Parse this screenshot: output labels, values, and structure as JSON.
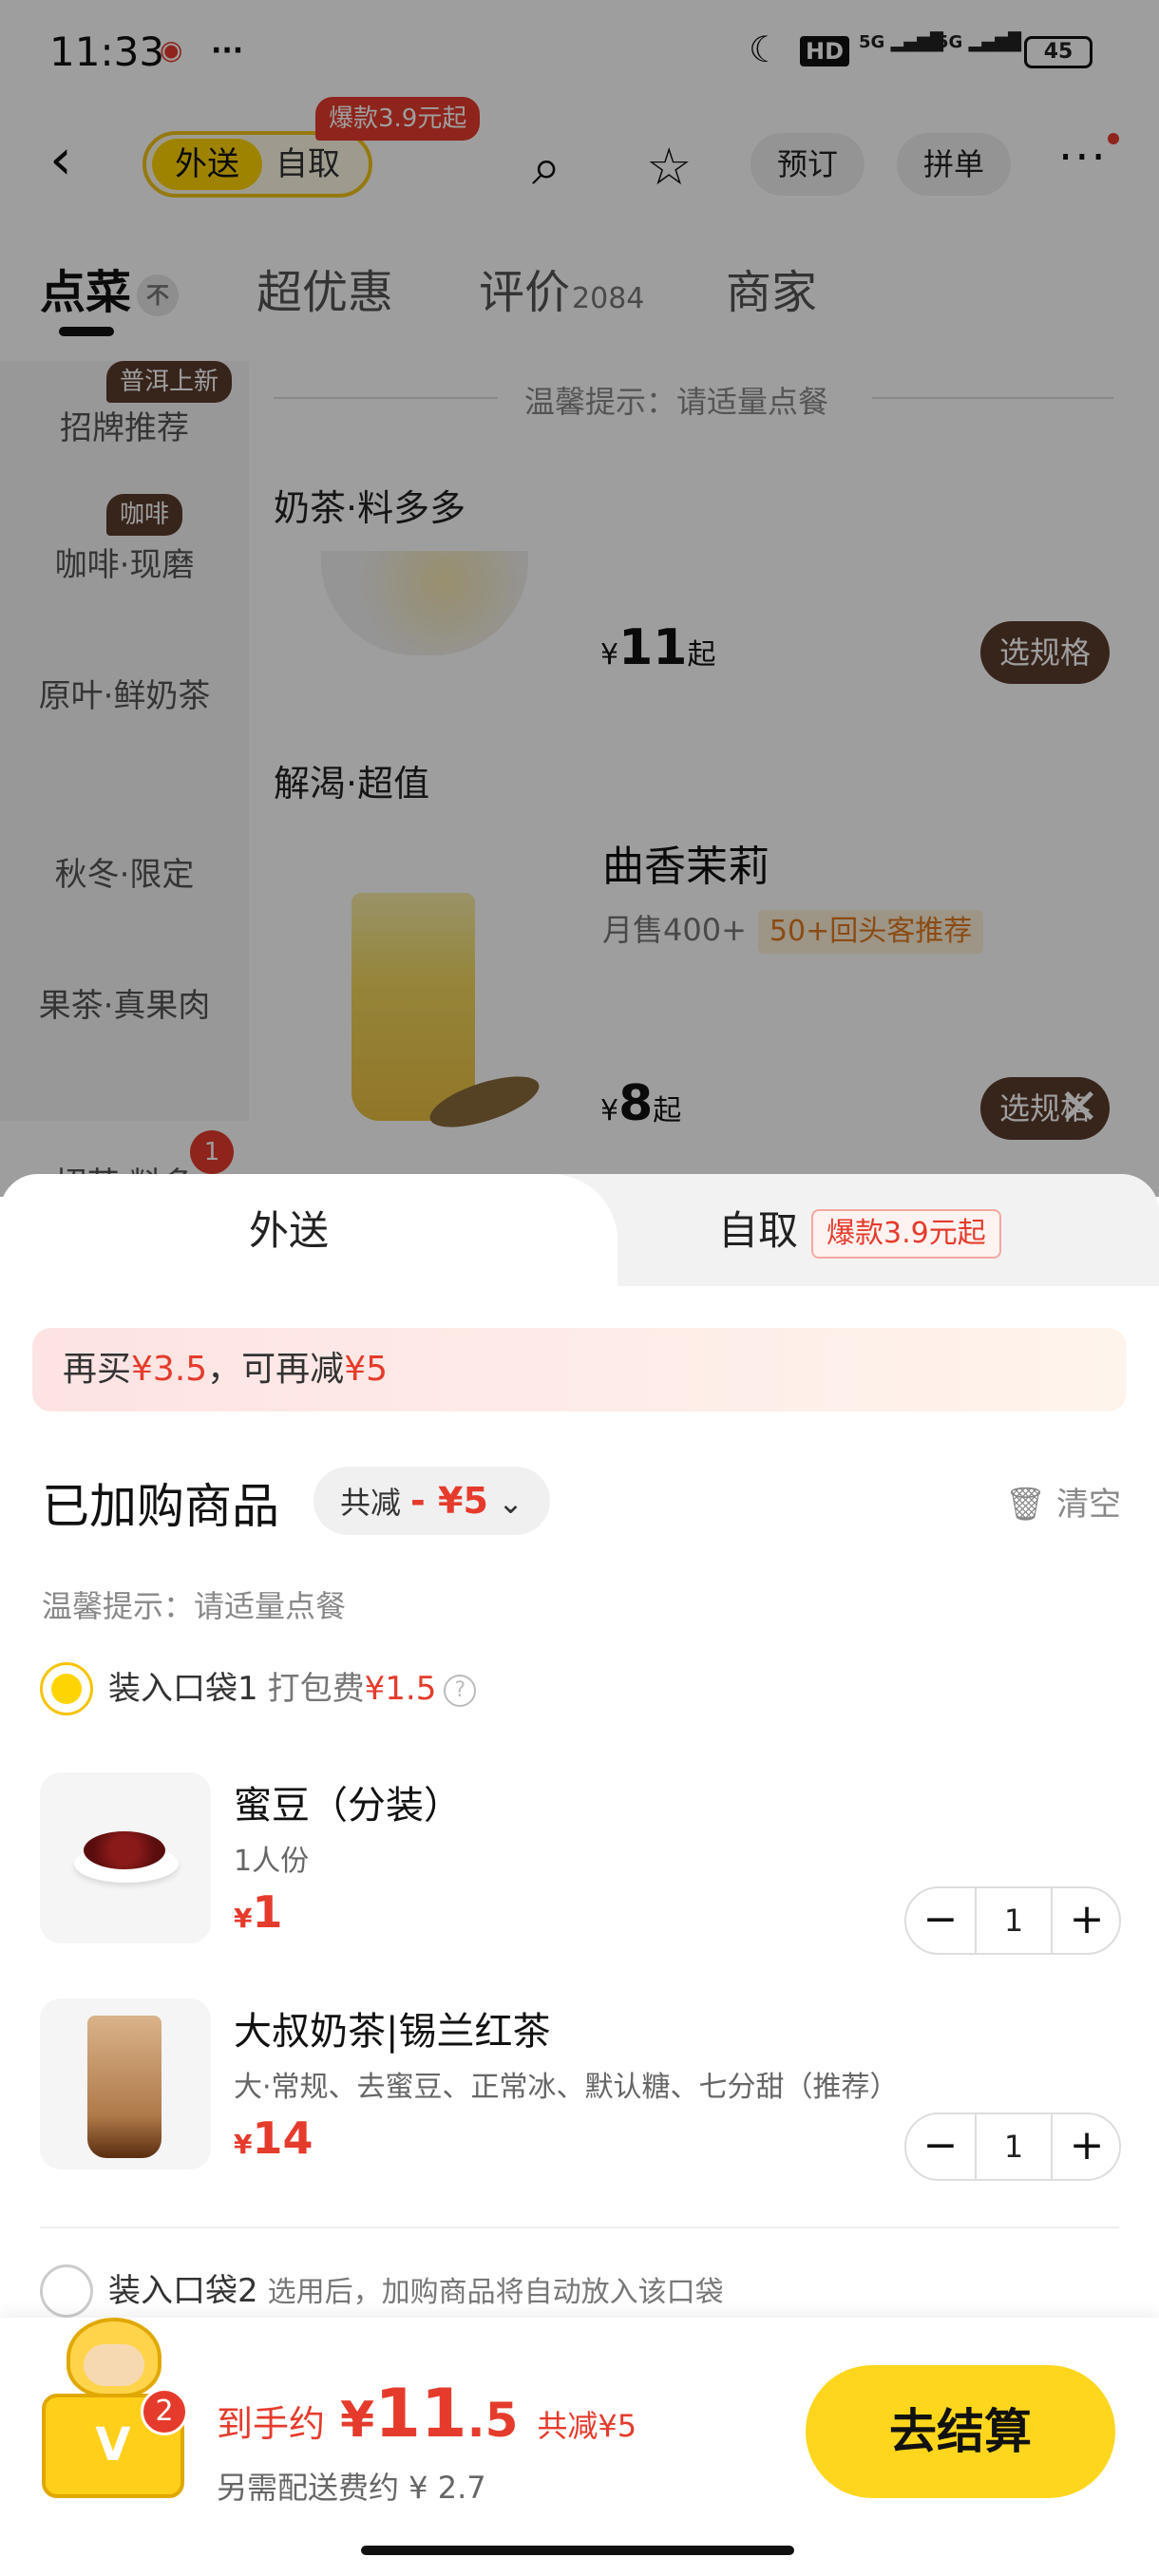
{
  "status": {
    "time": "11:33",
    "more": "···",
    "net1": "5G",
    "net2": "5G",
    "hd": "HD",
    "battery": "45"
  },
  "nav": {
    "mode_delivery": "外送",
    "mode_pickup": "自取",
    "hot_badge": "爆款3.9元起",
    "reserve": "预订",
    "group": "拼单"
  },
  "tabs": {
    "order": "点菜",
    "collapse": "不",
    "deals": "超优惠",
    "reviews": "评价",
    "reviews_count": "2084",
    "merchant": "商家"
  },
  "sidebar": {
    "items": [
      {
        "tag": "普洱上新",
        "label": "招牌推荐"
      },
      {
        "tag": "咖啡",
        "label": "咖啡·现磨"
      },
      {
        "label": "原叶·鲜奶茶"
      },
      {
        "label": "秋冬·限定"
      },
      {
        "label": "果茶·真果肉"
      },
      {
        "label": "招茶·料多",
        "count": "1"
      }
    ]
  },
  "menu": {
    "tip": "温馨提示：请适量点餐",
    "section1": "奶茶·料多多",
    "section1_price_yen": "¥",
    "section1_price": "11",
    "section1_price_suffix": "起",
    "spec_label": "选规格",
    "section2": "解渴·超值",
    "product2_name": "曲香茉莉",
    "product2_sales": "月售400+",
    "product2_badge": "50+回头客推荐",
    "product2_price_yen": "¥",
    "product2_price": "8",
    "product2_price_suffix": "起",
    "close": "✕"
  },
  "sheet": {
    "tab_delivery": "外送",
    "tab_pickup": "自取",
    "pickup_badge": "爆款3.9元起",
    "promo_a": "再买",
    "promo_amount": "¥3.5",
    "promo_b": "，可再减",
    "promo_discount": "¥5",
    "cart_title": "已加购商品",
    "discount_label": "共减",
    "discount_amount": "- ¥5",
    "clear_label": "清空",
    "warm_tip": "温馨提示：请适量点餐",
    "bag1_label": "装入口袋1",
    "bag1_fee_label": "打包费",
    "bag1_fee": "¥1.5",
    "bag2_label": "装入口袋2",
    "bag2_hint": "选用后，加购商品将自动放入该口袋",
    "items": [
      {
        "name": "蜜豆（分装）",
        "desc": "1人份",
        "yen": "¥",
        "price": "1",
        "qty": "1"
      },
      {
        "name": "大叔奶茶|锡兰红茶",
        "desc": "大·常规、去蜜豆、正常冰、默认糖、七分甜（推荐）",
        "yen": "¥",
        "price": "14",
        "qty": "1"
      }
    ]
  },
  "checkout": {
    "count": "2",
    "est_label": "到手约",
    "yen": "¥",
    "total_int": "11",
    "total_dec": ".5",
    "saved": "共减¥5",
    "delivery_fee": "另需配送费约 ¥ 2.7",
    "button": "去结算",
    "mascot_mark": "V"
  },
  "colors": {
    "accent_yellow": "#ffd400",
    "price_red": "#e53b2c",
    "tag_brown": "#5a3a2c"
  }
}
